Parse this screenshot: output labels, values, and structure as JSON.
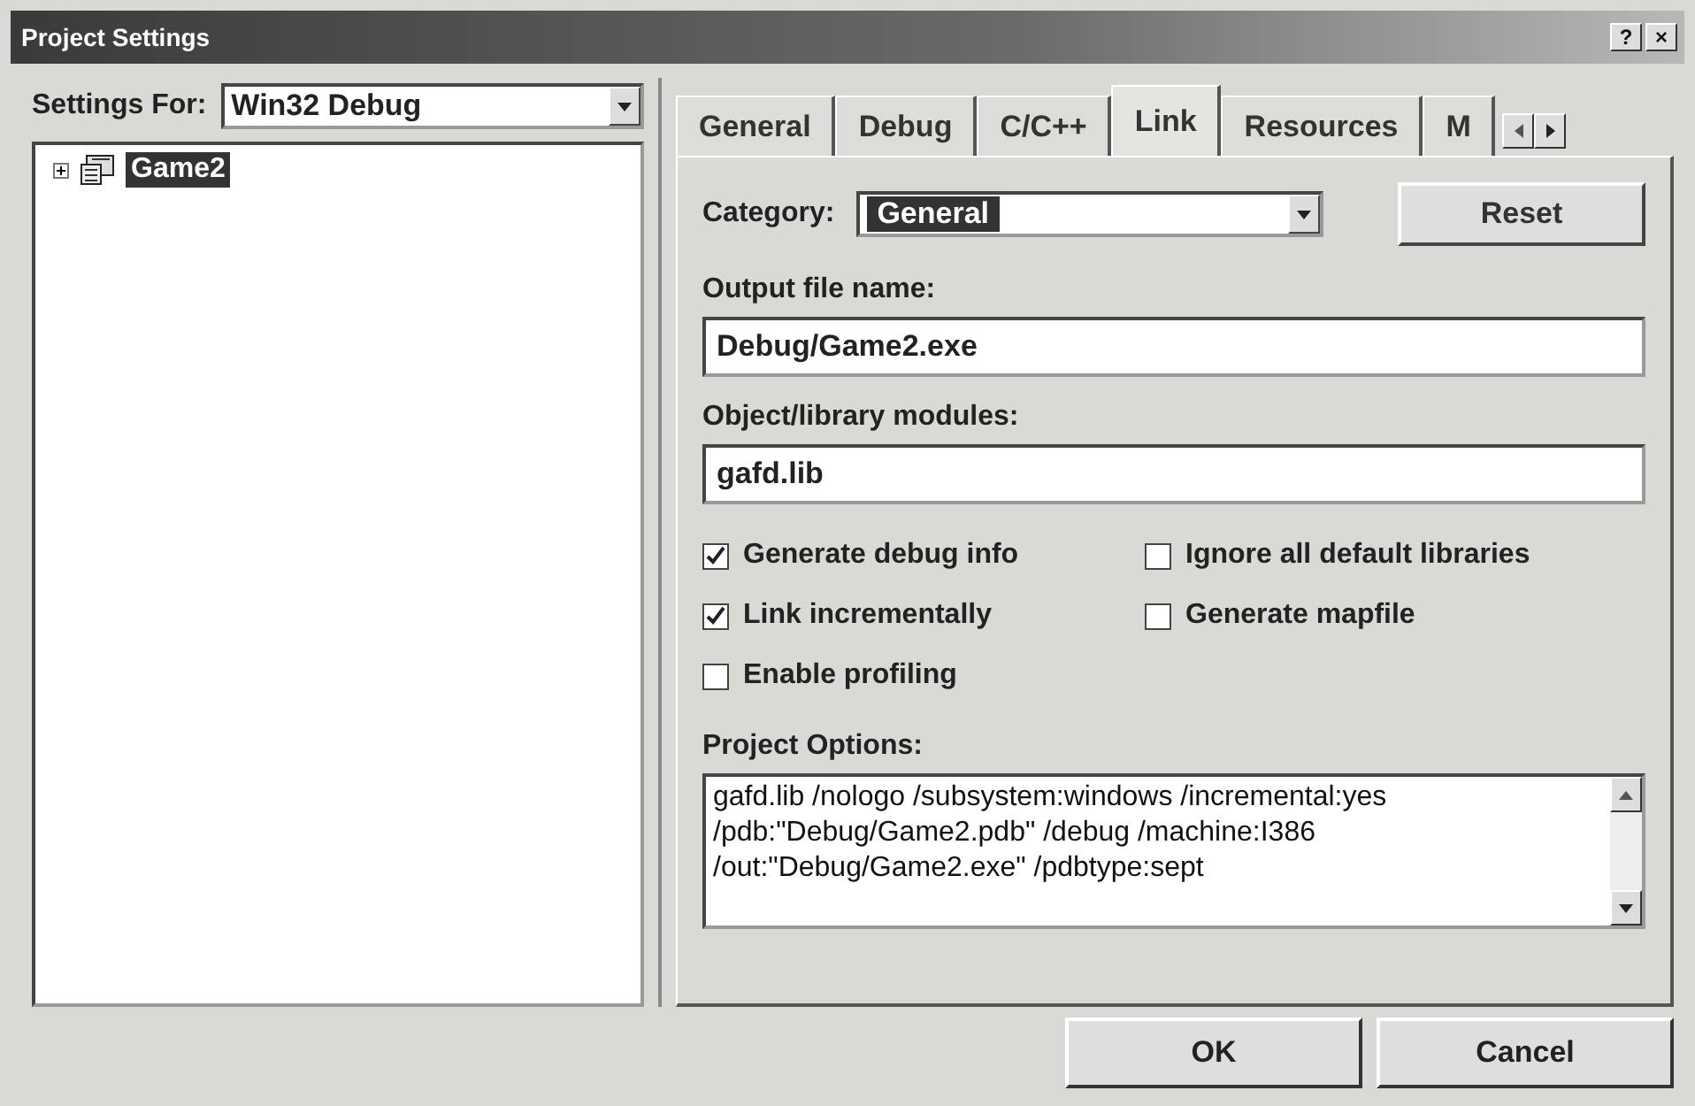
{
  "window": {
    "title": "Project Settings",
    "buttons": [
      "?",
      "×"
    ]
  },
  "settings_for": {
    "label": "Settings For:",
    "value": "Win32 Debug"
  },
  "tree": [
    {
      "label": "Game2",
      "selected": true,
      "expanded": false
    }
  ],
  "tabs": [
    {
      "label": "General",
      "selected": false
    },
    {
      "label": "Debug",
      "selected": false
    },
    {
      "label": "C/C++",
      "selected": false
    },
    {
      "label": "Link",
      "selected": true
    },
    {
      "label": "Resources",
      "selected": false
    },
    {
      "label": "M",
      "selected": false
    }
  ],
  "category": {
    "label": "Category:",
    "value": "General"
  },
  "reset_button": "Reset",
  "fields": [
    {
      "label": "Output file name:",
      "value": "Debug/Game2.exe"
    },
    {
      "label": "Object/library modules:",
      "value": "gafd.lib"
    }
  ],
  "checkboxes": [
    {
      "label": "Generate debug info",
      "checked": true
    },
    {
      "label": "Ignore all default libraries",
      "checked": false
    },
    {
      "label": "Link incrementally",
      "checked": true
    },
    {
      "label": "Generate mapfile",
      "checked": false
    },
    {
      "label": "Enable profiling",
      "checked": false
    }
  ],
  "project_options": {
    "label": "Project Options:",
    "lines": [
      "gafd.lib /nologo /subsystem:windows /incremental:yes",
      "/pdb:\"Debug/Game2.pdb\" /debug /machine:I386",
      "/out:\"Debug/Game2.exe\" /pdbtype:sept"
    ]
  },
  "buttons": [
    "OK",
    "Cancel"
  ]
}
